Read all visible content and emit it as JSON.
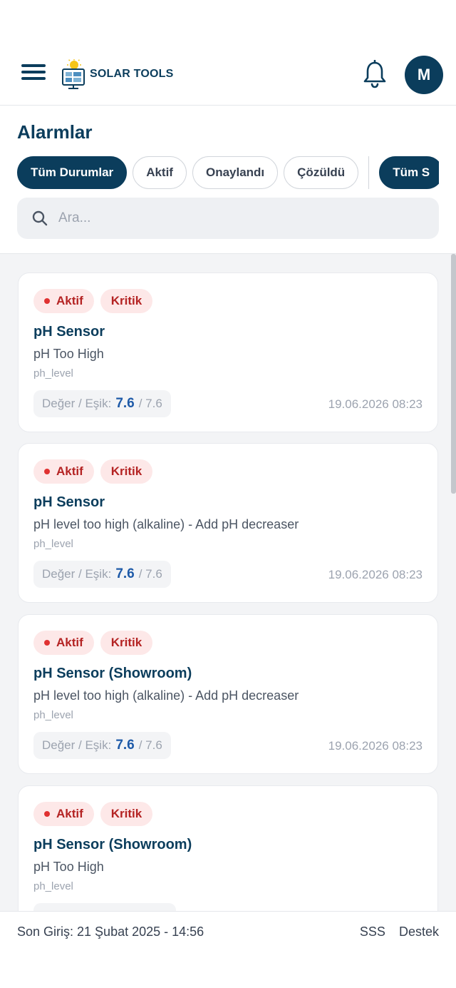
{
  "header": {
    "brand": "SOLAR TOOLS",
    "avatar_initial": "M"
  },
  "page": {
    "title": "Alarmlar"
  },
  "filters": {
    "status": [
      "Tüm Durumlar",
      "Aktif",
      "Onaylandı",
      "Çözüldü"
    ],
    "severity_first": "Tüm S"
  },
  "search": {
    "placeholder": "Ara..."
  },
  "alarms": [
    {
      "status": "Aktif",
      "severity": "Kritik",
      "device": "pH Sensor",
      "message": "pH Too High",
      "metric_key": "ph_level",
      "metric_label": "Değer / Eşik:",
      "value": "7.6",
      "threshold": "/ 7.6",
      "time": "19.06.2026 08:23"
    },
    {
      "status": "Aktif",
      "severity": "Kritik",
      "device": "pH Sensor",
      "message": "pH level too high (alkaline) - Add pH decreaser",
      "metric_key": "ph_level",
      "metric_label": "Değer / Eşik:",
      "value": "7.6",
      "threshold": "/ 7.6",
      "time": "19.06.2026 08:23"
    },
    {
      "status": "Aktif",
      "severity": "Kritik",
      "device": "pH Sensor (Showroom)",
      "message": "pH level too high (alkaline) - Add pH decreaser",
      "metric_key": "ph_level",
      "metric_label": "Değer / Eşik:",
      "value": "7.6",
      "threshold": "/ 7.6",
      "time": "19.06.2026 08:23"
    },
    {
      "status": "Aktif",
      "severity": "Kritik",
      "device": "pH Sensor (Showroom)",
      "message": "pH Too High",
      "metric_key": "ph_level"
    }
  ],
  "footer": {
    "last_login": "Son Giriş: 21 Şubat 2025 - 14:56",
    "faq": "SSS",
    "support": "Destek"
  },
  "colors": {
    "brand": "#0b3d5c",
    "critical_bg": "#fde8e8",
    "critical_text": "#b42323",
    "value": "#1e5aa8"
  }
}
